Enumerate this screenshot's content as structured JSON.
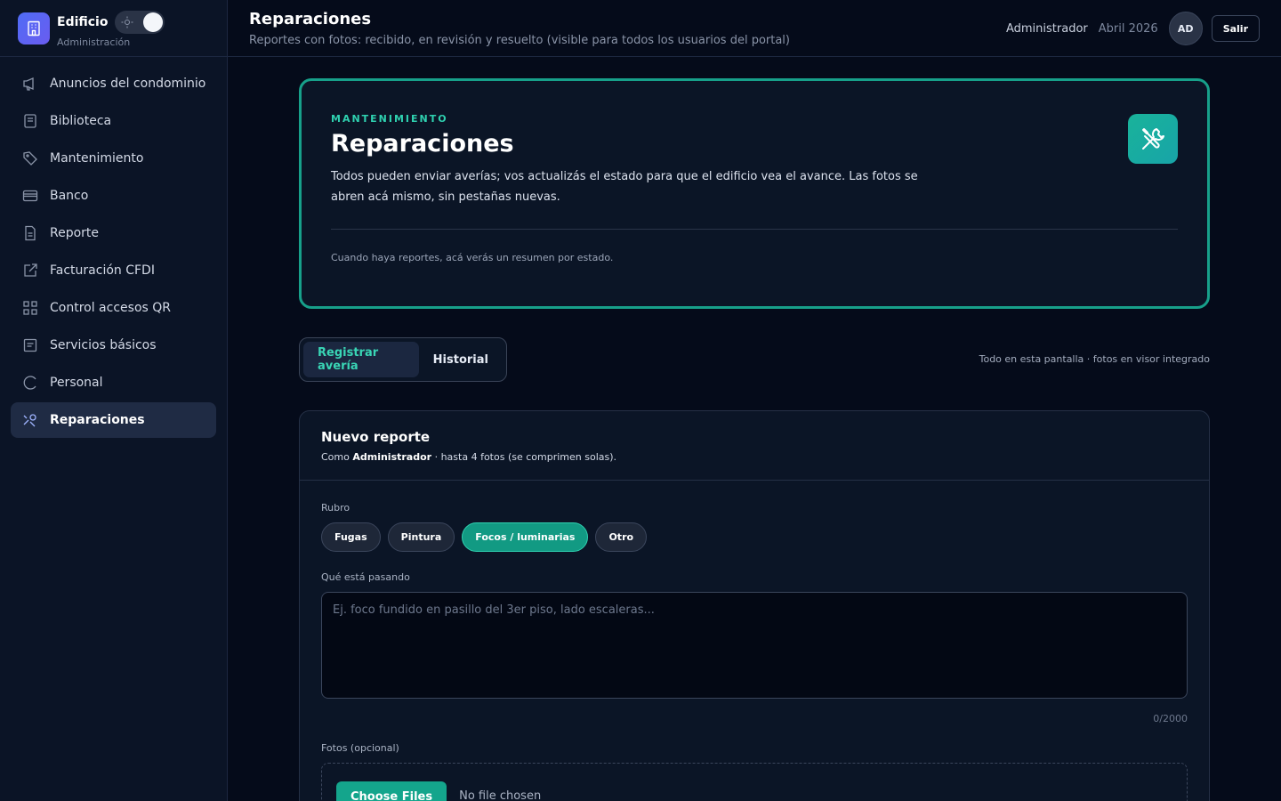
{
  "brand": {
    "title": "Edificio",
    "subtitle": "Administración"
  },
  "sidebar": {
    "items": [
      {
        "label": "Anuncios del condominio",
        "icon": "megaphone-icon"
      },
      {
        "label": "Biblioteca",
        "icon": "book-icon"
      },
      {
        "label": "Mantenimiento",
        "icon": "tag-icon"
      },
      {
        "label": "Banco",
        "icon": "card-icon"
      },
      {
        "label": "Reporte",
        "icon": "document-icon"
      },
      {
        "label": "Facturación CFDI",
        "icon": "external-edit-icon"
      },
      {
        "label": "Control accesos QR",
        "icon": "qr-grid-icon"
      },
      {
        "label": "Servicios básicos",
        "icon": "list-box-icon"
      },
      {
        "label": "Personal",
        "icon": "loading-icon"
      },
      {
        "label": "Reparaciones",
        "icon": "tools-icon",
        "active": true
      }
    ]
  },
  "header": {
    "title": "Reparaciones",
    "subtitle": "Reportes con fotos: recibido, en revisión y resuelto (visible para todos los usuarios del portal)",
    "role": "Administrador",
    "month": "Abril 2026",
    "avatar": "AD",
    "logout": "Salir"
  },
  "hero": {
    "eyebrow": "MANTENIMIENTO",
    "title": "Reparaciones",
    "description": "Todos pueden enviar averías; vos actualizás el estado para que el edificio vea el avance. Las fotos se abren acá mismo, sin pestañas nuevas.",
    "note": "Cuando haya reportes, acá verás un resumen por estado."
  },
  "tabs": [
    {
      "label": "Registrar avería",
      "active": true
    },
    {
      "label": "Historial",
      "active": false
    }
  ],
  "screen_note": "Todo en esta pantalla · fotos en visor integrado",
  "form": {
    "title": "Nuevo reporte",
    "meta_prefix": "Como",
    "meta_user": "Administrador",
    "meta_suffix": "· hasta 4 fotos (se comprimen solas).",
    "category_label": "Rubro",
    "categories": [
      {
        "label": "Fugas",
        "active": false
      },
      {
        "label": "Pintura",
        "active": false
      },
      {
        "label": "Focos / luminarias",
        "active": true
      },
      {
        "label": "Otro",
        "active": false
      }
    ],
    "description_label": "Qué está pasando",
    "description_placeholder": "Ej. foco fundido en pasillo del 3er piso, lado escaleras...",
    "description_value": "",
    "counter": "0/2000",
    "photos_label": "Fotos (opcional)",
    "file_button": "Choose Files",
    "file_status": "No file chosen"
  },
  "colors": {
    "accent": "#2fd1b0",
    "brand": "#4f6cf5",
    "active_chip": "#129a83"
  }
}
